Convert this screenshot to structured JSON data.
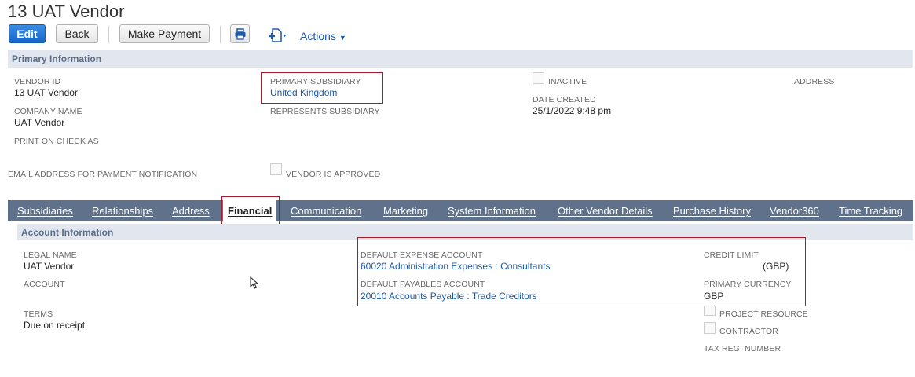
{
  "page": {
    "title": "13 UAT Vendor"
  },
  "toolbar": {
    "edit": "Edit",
    "back": "Back",
    "make_payment": "Make Payment",
    "actions": "Actions"
  },
  "primary": {
    "heading": "Primary Information",
    "vendor_id_label": "VENDOR ID",
    "vendor_id": "13 UAT Vendor",
    "company_name_label": "COMPANY NAME",
    "company_name": "UAT Vendor",
    "print_on_check_label": "PRINT ON CHECK AS",
    "email_payment_label": "EMAIL ADDRESS FOR PAYMENT NOTIFICATION",
    "primary_subsidiary_label": "PRIMARY SUBSIDIARY",
    "primary_subsidiary": "United Kingdom",
    "represents_subsidiary_label": "REPRESENTS SUBSIDIARY",
    "vendor_approved_label": "VENDOR IS APPROVED",
    "inactive_label": "INACTIVE",
    "date_created_label": "DATE CREATED",
    "date_created": "25/1/2022 9:48 pm",
    "address_label": "ADDRESS"
  },
  "tabs": [
    "Subsidiaries",
    "Relationships",
    "Address",
    "Financial",
    "Communication",
    "Marketing",
    "System Information",
    "Other Vendor Details",
    "Purchase History",
    "Vendor360",
    "Time Tracking"
  ],
  "account": {
    "heading": "Account Information",
    "legal_name_label": "LEGAL NAME",
    "legal_name": "UAT Vendor",
    "account_label": "ACCOUNT",
    "terms_label": "TERMS",
    "terms": "Due on receipt",
    "default_expense_label": "DEFAULT EXPENSE ACCOUNT",
    "default_expense": "60020 Administration Expenses : Consultants",
    "default_payables_label": "DEFAULT PAYABLES ACCOUNT",
    "default_payables": "20010 Accounts Payable : Trade Creditors",
    "credit_limit_label": "CREDIT LIMIT",
    "credit_limit_currency": "(GBP)",
    "primary_currency_label": "PRIMARY CURRENCY",
    "primary_currency": "GBP",
    "project_resource_label": "PROJECT RESOURCE",
    "contractor_label": "CONTRACTOR",
    "tax_reg_label": "TAX REG. NUMBER"
  },
  "colors": {
    "primary_button": "#1667c6",
    "tab_bar": "#5f718b",
    "section_bar": "#e2e7ef",
    "highlight_box": "#a31e2a",
    "link": "#1f5aa6"
  }
}
